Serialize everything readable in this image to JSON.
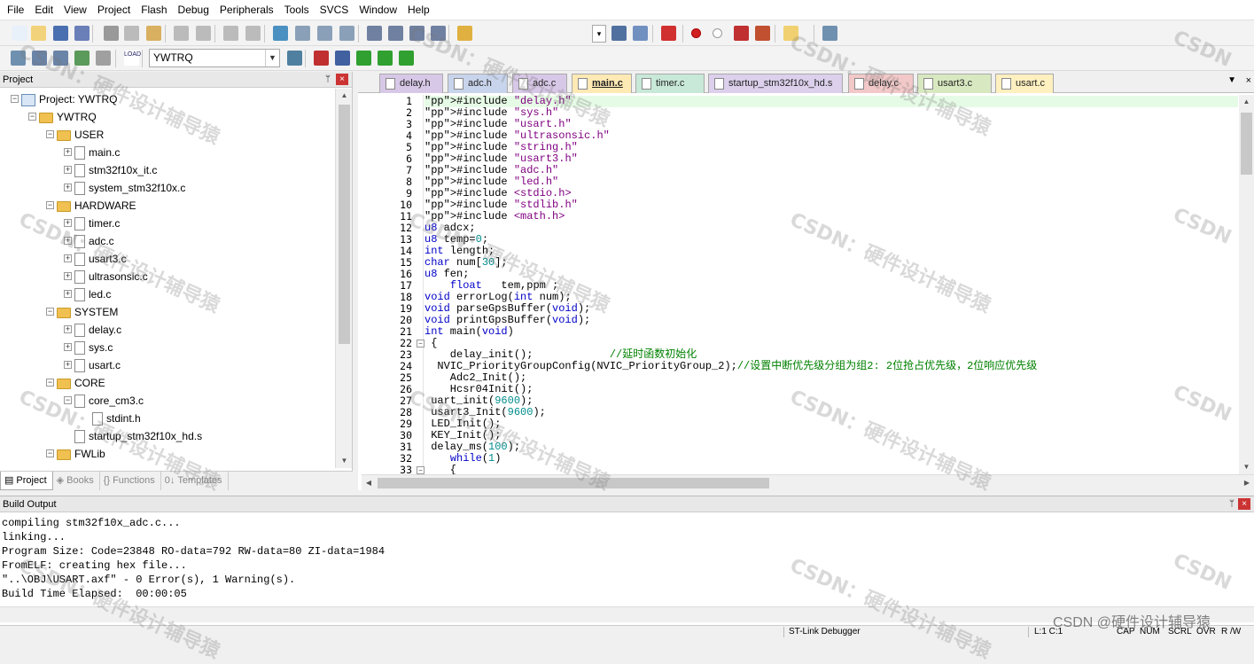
{
  "menu": [
    "File",
    "Edit",
    "View",
    "Project",
    "Flash",
    "Debug",
    "Peripherals",
    "Tools",
    "SVCS",
    "Window",
    "Help"
  ],
  "toolbar": {
    "target_name": "YWTRQ",
    "find_value": "",
    "icons": [
      "new-file-icon",
      "open-file-icon",
      "save-icon",
      "save-all-icon",
      "cut-icon",
      "copy-icon",
      "paste-icon",
      "undo-icon",
      "redo-icon",
      "back-icon",
      "forward-icon",
      "bookmark-icon",
      "prev-bookmark-icon",
      "next-bookmark-icon",
      "clear-bookmarks-icon",
      "indent-icon",
      "unindent-icon",
      "comment-icon",
      "uncomment-icon",
      "find-in-files-icon",
      "find-icon",
      "incremental-find-icon",
      "debug-start-icon",
      "breakpoint-icon",
      "disable-breakpoint-icon",
      "kill-breakpoints-icon",
      "kill-all-breakpoints-icon",
      "window-layout-icon",
      "configure-icon"
    ],
    "build_icons": [
      "translate-icon",
      "build-icon",
      "rebuild-icon",
      "batch-build-icon",
      "stop-build-icon",
      "download-icon",
      "target-options-icon",
      "manage-components-icon",
      "file-extensions-icon",
      "select-packs-icon",
      "pack-installer-icon"
    ],
    "download_label": "LOAD"
  },
  "project": {
    "panel_title": "Project",
    "pin": "ᛘ",
    "close": "×",
    "tree": [
      {
        "label": "Project: YWTRQ",
        "level": 0,
        "kind": "project",
        "expand": "−"
      },
      {
        "label": "YWTRQ",
        "level": 1,
        "kind": "folder",
        "expand": "−"
      },
      {
        "label": "USER",
        "level": 2,
        "kind": "folder",
        "expand": "−"
      },
      {
        "label": "main.c",
        "level": 3,
        "kind": "file",
        "expand": "+"
      },
      {
        "label": "stm32f10x_it.c",
        "level": 3,
        "kind": "file",
        "expand": "+"
      },
      {
        "label": "system_stm32f10x.c",
        "level": 3,
        "kind": "file",
        "expand": "+"
      },
      {
        "label": "HARDWARE",
        "level": 2,
        "kind": "folder",
        "expand": "−"
      },
      {
        "label": "timer.c",
        "level": 3,
        "kind": "file",
        "expand": "+"
      },
      {
        "label": "adc.c",
        "level": 3,
        "kind": "file",
        "expand": "+"
      },
      {
        "label": "usart3.c",
        "level": 3,
        "kind": "file",
        "expand": "+"
      },
      {
        "label": "ultrasonsic.c",
        "level": 3,
        "kind": "file",
        "expand": "+"
      },
      {
        "label": "led.c",
        "level": 3,
        "kind": "file",
        "expand": "+"
      },
      {
        "label": "SYSTEM",
        "level": 2,
        "kind": "folder",
        "expand": "−"
      },
      {
        "label": "delay.c",
        "level": 3,
        "kind": "file",
        "expand": "+"
      },
      {
        "label": "sys.c",
        "level": 3,
        "kind": "file",
        "expand": "+"
      },
      {
        "label": "usart.c",
        "level": 3,
        "kind": "file",
        "expand": "+"
      },
      {
        "label": "CORE",
        "level": 2,
        "kind": "folder",
        "expand": "−"
      },
      {
        "label": "core_cm3.c",
        "level": 3,
        "kind": "file",
        "expand": "−"
      },
      {
        "label": "stdint.h",
        "level": 4,
        "kind": "file",
        "expand": ""
      },
      {
        "label": "startup_stm32f10x_hd.s",
        "level": 3,
        "kind": "file",
        "expand": ""
      },
      {
        "label": "FWLib",
        "level": 2,
        "kind": "folder",
        "expand": "−"
      }
    ],
    "tabs": [
      "Project",
      "Books",
      "Functions",
      "Templates"
    ],
    "tab_icons": [
      "project-tab-icon",
      "books-tab-icon",
      "functions-tab-icon",
      "templates-tab-icon"
    ],
    "tab_glyphs": [
      "▤",
      "◈",
      "{}",
      "0↓"
    ]
  },
  "editor": {
    "tabs": [
      {
        "label": "delay.h",
        "color": "#d8c8e8",
        "active": false
      },
      {
        "label": "adc.h",
        "color": "#c8d4ec",
        "active": false
      },
      {
        "label": "adc.c",
        "color": "#d8c8e8",
        "active": false
      },
      {
        "label": "main.c",
        "color": "#ffe9b5",
        "active": true
      },
      {
        "label": "timer.c",
        "color": "#c8e8d8",
        "active": false
      },
      {
        "label": "startup_stm32f10x_hd.s",
        "color": "#dcd0ec",
        "active": false
      },
      {
        "label": "delay.c",
        "color": "#f2c8c8",
        "active": false
      },
      {
        "label": "usart3.c",
        "color": "#d8e8c0",
        "active": false
      },
      {
        "label": "usart.c",
        "color": "#fff0c0",
        "active": false
      }
    ],
    "tab_menu": "▼",
    "tab_close": "×",
    "lines": [
      {
        "n": "1",
        "t": "#include \"delay.h\""
      },
      {
        "n": "2",
        "t": "#include \"sys.h\""
      },
      {
        "n": "3",
        "t": "#include \"usart.h\""
      },
      {
        "n": "4",
        "t": "#include \"ultrasonsic.h\""
      },
      {
        "n": "5",
        "t": "#include \"string.h\""
      },
      {
        "n": "6",
        "t": "#include \"usart3.h\""
      },
      {
        "n": "7",
        "t": "#include \"adc.h\""
      },
      {
        "n": "8",
        "t": "#include \"led.h\""
      },
      {
        "n": "9",
        "t": "#include <stdio.h>"
      },
      {
        "n": "10",
        "t": "#include \"stdlib.h\""
      },
      {
        "n": "11",
        "t": "#include <math.h>"
      },
      {
        "n": "12",
        "t": "u8 adcx;"
      },
      {
        "n": "13",
        "t": "u8 temp=0;"
      },
      {
        "n": "14",
        "t": "int length;"
      },
      {
        "n": "15",
        "t": "char num[30];"
      },
      {
        "n": "16",
        "t": "u8 fen;"
      },
      {
        "n": "17",
        "t": "    float   tem,ppm ;"
      },
      {
        "n": "18",
        "t": "void errorLog(int num);"
      },
      {
        "n": "19",
        "t": "void parseGpsBuffer(void);"
      },
      {
        "n": "20",
        "t": "void printGpsBuffer(void);"
      },
      {
        "n": "21",
        "t": "int main(void)"
      },
      {
        "n": "22",
        "t": " {"
      },
      {
        "n": "23",
        "t": "    delay_init();            //延时函数初始化"
      },
      {
        "n": "24",
        "t": "  NVIC_PriorityGroupConfig(NVIC_PriorityGroup_2);//设置中断优先级分组为组2: 2位抢占优先级，2位响应优先级"
      },
      {
        "n": "25",
        "t": "    Adc2_Init();"
      },
      {
        "n": "26",
        "t": "    Hcsr04Init();"
      },
      {
        "n": "27",
        "t": " uart_init(9600);"
      },
      {
        "n": "28",
        "t": " usart3_Init(9600);"
      },
      {
        "n": "29",
        "t": " LED_Init();"
      },
      {
        "n": "30",
        "t": " KEY_Init();"
      },
      {
        "n": "31",
        "t": " delay_ms(100);"
      },
      {
        "n": "32",
        "t": "    while(1)"
      },
      {
        "n": "33",
        "t": "    {"
      }
    ]
  },
  "build": {
    "title": "Build Output",
    "pin": "ᛘ",
    "close": "×",
    "lines": [
      "compiling stm32f10x_adc.c...",
      "linking...",
      "Program Size: Code=23848 RO-data=792 RW-data=80 ZI-data=1984",
      "FromELF: creating hex file...",
      "\"..\\OBJ\\USART.axf\" - 0 Error(s), 1 Warning(s).",
      "Build Time Elapsed:  00:00:05"
    ]
  },
  "status": {
    "debugger": "ST-Link Debugger",
    "position": "L:1 C:1",
    "caps": "CAP",
    "num": "NUM",
    "scrl": "SCRL",
    "ovr": "OVR",
    "rw": "R /W"
  },
  "watermark": {
    "text": "CSDN：硬件设计辅导猿",
    "short": "CSDN",
    "credit": "CSDN @硬件设计辅导猿"
  },
  "colors": {
    "keyword": "#0000c8",
    "preprocessor": "#006400",
    "string": "#800080",
    "number": "#008c8c",
    "comment": "#008000",
    "current_line": "#e6fbe6",
    "active_tab": "#ffe9b5"
  }
}
